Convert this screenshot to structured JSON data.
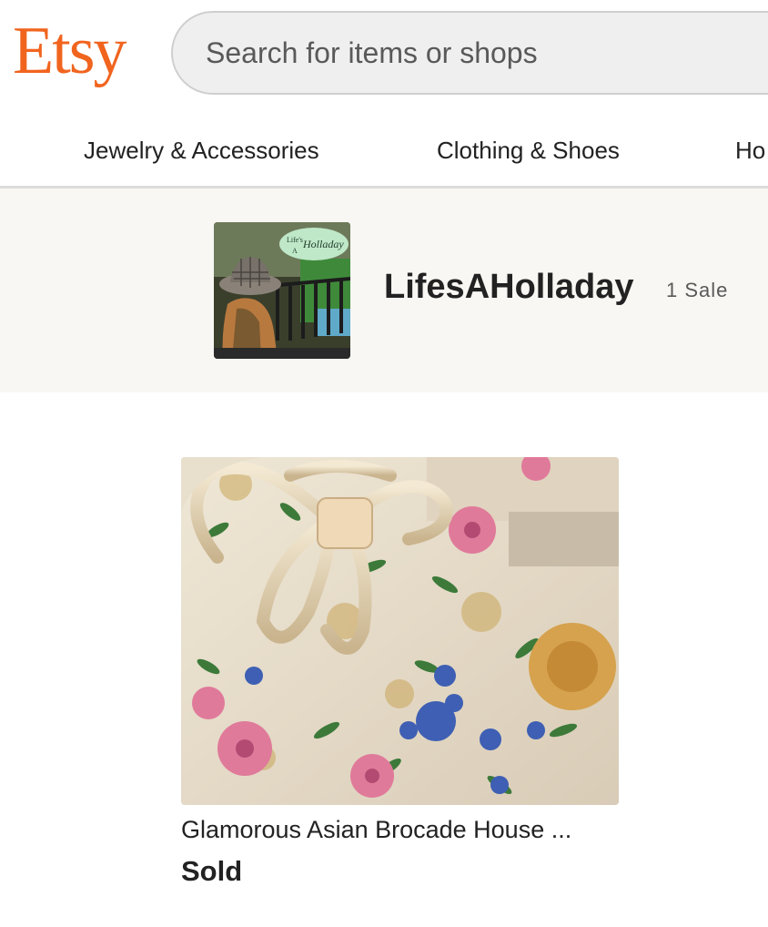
{
  "header": {
    "logo_text": "Etsy",
    "search_placeholder": "Search for items or shops",
    "brand_color": "#F1641E"
  },
  "nav": {
    "items": [
      {
        "label": "Jewelry & Accessories"
      },
      {
        "label": "Clothing & Shoes"
      },
      {
        "label": "Ho"
      }
    ]
  },
  "shop": {
    "name": "LifesAHolladay",
    "sales": "1 Sale",
    "avatar_badge_text": "Life's A Holladay"
  },
  "listing": {
    "title": "Glamorous Asian Brocade House ...",
    "status": "Sold"
  }
}
